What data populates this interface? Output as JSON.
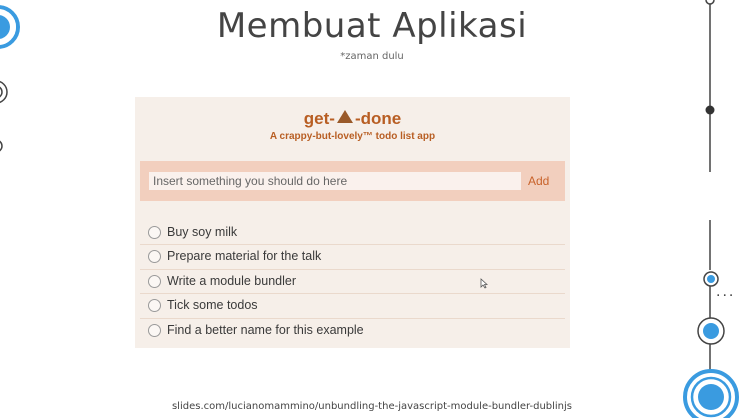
{
  "slide": {
    "title": "Membuat Aplikasi",
    "subtitle": "*zaman dulu",
    "footer_link": "slides.com/lucianomammino/unbundling-the-javascript-module-bundler-dublinjs"
  },
  "app": {
    "title_left": "get-",
    "title_right": "-done",
    "title_icon": "poop-icon",
    "tagline": "A crappy-but-lovely™ todo list app",
    "input": {
      "placeholder": "Insert something you should do here",
      "value": ""
    },
    "add_label": "Add",
    "todos": [
      {
        "text": "Buy soy milk",
        "done": false
      },
      {
        "text": "Prepare material for the talk",
        "done": false
      },
      {
        "text": "Write a module bundler",
        "done": false
      },
      {
        "text": "Tick some todos",
        "done": false
      },
      {
        "text": "Find a better name for this example",
        "done": false
      }
    ]
  },
  "colors": {
    "accent": "#b85e23",
    "input_bar": "#f2cfbe",
    "app_bg": "#f6efe9",
    "deco_blue": "#3a9be0"
  },
  "decorations": {
    "ellipsis": "..."
  }
}
